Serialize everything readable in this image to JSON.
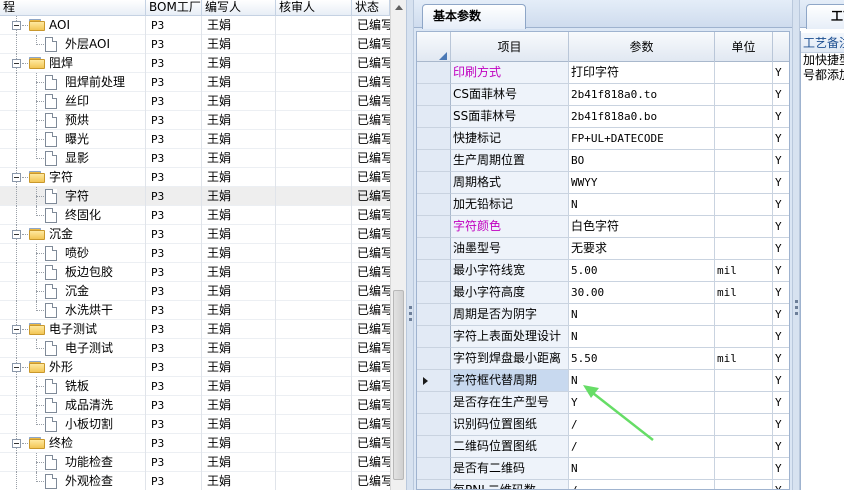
{
  "tree": {
    "columns": [
      "程",
      "BOM工厂",
      "编写人",
      "核审人",
      "状态"
    ],
    "rows": [
      {
        "label": "AOI",
        "type": "folder",
        "factory": "P3",
        "writer": "王娟",
        "status": "已编写"
      },
      {
        "label": "外层AOI",
        "type": "doc",
        "factory": "P3",
        "writer": "王娟",
        "status": "已编写"
      },
      {
        "label": "阻焊",
        "type": "folder",
        "factory": "P3",
        "writer": "王娟",
        "status": "已编写"
      },
      {
        "label": "阻焊前处理",
        "type": "doc",
        "factory": "P3",
        "writer": "王娟",
        "status": "已编写"
      },
      {
        "label": "丝印",
        "type": "doc",
        "factory": "P3",
        "writer": "王娟",
        "status": "已编写"
      },
      {
        "label": "预烘",
        "type": "doc",
        "factory": "P3",
        "writer": "王娟",
        "status": "已编写"
      },
      {
        "label": "曝光",
        "type": "doc",
        "factory": "P3",
        "writer": "王娟",
        "status": "已编写"
      },
      {
        "label": "显影",
        "type": "doc",
        "factory": "P3",
        "writer": "王娟",
        "status": "已编写"
      },
      {
        "label": "字符",
        "type": "folder",
        "factory": "P3",
        "writer": "王娟",
        "status": "已编写"
      },
      {
        "label": "字符",
        "type": "doc",
        "factory": "P3",
        "writer": "王娟",
        "status": "已编写",
        "selected": true
      },
      {
        "label": "终固化",
        "type": "doc",
        "factory": "P3",
        "writer": "王娟",
        "status": "已编写"
      },
      {
        "label": "沉金",
        "type": "folder",
        "factory": "P3",
        "writer": "王娟",
        "status": "已编写"
      },
      {
        "label": "喷砂",
        "type": "doc",
        "factory": "P3",
        "writer": "王娟",
        "status": "已编写"
      },
      {
        "label": "板边包胶",
        "type": "doc",
        "factory": "P3",
        "writer": "王娟",
        "status": "已编写"
      },
      {
        "label": "沉金",
        "type": "doc",
        "factory": "P3",
        "writer": "王娟",
        "status": "已编写"
      },
      {
        "label": "水洗烘干",
        "type": "doc",
        "factory": "P3",
        "writer": "王娟",
        "status": "已编写"
      },
      {
        "label": "电子测试",
        "type": "folder",
        "factory": "P3",
        "writer": "王娟",
        "status": "已编写"
      },
      {
        "label": "电子测试",
        "type": "doc",
        "factory": "P3",
        "writer": "王娟",
        "status": "已编写"
      },
      {
        "label": "外形",
        "type": "folder",
        "factory": "P3",
        "writer": "王娟",
        "status": "已编写"
      },
      {
        "label": "铣板",
        "type": "doc",
        "factory": "P3",
        "writer": "王娟",
        "status": "已编写"
      },
      {
        "label": "成品清洗",
        "type": "doc",
        "factory": "P3",
        "writer": "王娟",
        "status": "已编写"
      },
      {
        "label": "小板切割",
        "type": "doc",
        "factory": "P3",
        "writer": "王娟",
        "status": "已编写"
      },
      {
        "label": "终检",
        "type": "folder",
        "factory": "P3",
        "writer": "王娟",
        "status": "已编写"
      },
      {
        "label": "功能检查",
        "type": "doc",
        "factory": "P3",
        "writer": "王娟",
        "status": "已编写"
      },
      {
        "label": "外观检查",
        "type": "doc",
        "factory": "P3",
        "writer": "王娟",
        "status": "已编写"
      }
    ]
  },
  "params": {
    "tab_label": "基本参数",
    "columns": {
      "item": "项目",
      "value": "参数",
      "unit": "单位"
    },
    "rows": [
      {
        "item": "印刷方式",
        "value": "打印字符",
        "unit": "",
        "extra": "Y",
        "highlight": true
      },
      {
        "item": "CS面菲林号",
        "value": "2b41f818a0.to",
        "unit": "",
        "extra": "Y"
      },
      {
        "item": "SS面菲林号",
        "value": "2b41f818a0.bo",
        "unit": "",
        "extra": "Y"
      },
      {
        "item": "快捷标记",
        "value": "FP+UL+DATECODE",
        "unit": "",
        "extra": "Y"
      },
      {
        "item": "生产周期位置",
        "value": "BO",
        "unit": "",
        "extra": "Y"
      },
      {
        "item": "周期格式",
        "value": "WWYY",
        "unit": "",
        "extra": "Y"
      },
      {
        "item": "加无铅标记",
        "value": "N",
        "unit": "",
        "extra": "Y"
      },
      {
        "item": "字符颜色",
        "value": "白色字符",
        "unit": "",
        "extra": "Y",
        "highlight": true
      },
      {
        "item": "油墨型号",
        "value": "无要求",
        "unit": "",
        "extra": "Y"
      },
      {
        "item": "最小字符线宽",
        "value": "5.00",
        "unit": "mil",
        "extra": "Y"
      },
      {
        "item": "最小字符高度",
        "value": "30.00",
        "unit": "mil",
        "extra": "Y"
      },
      {
        "item": "周期是否为阴字",
        "value": "N",
        "unit": "",
        "extra": "Y"
      },
      {
        "item": "字符上表面处理设计",
        "value": "N",
        "unit": "",
        "extra": "Y"
      },
      {
        "item": "字符到焊盘最小距离",
        "value": "5.50",
        "unit": "mil",
        "extra": "Y"
      },
      {
        "item": "字符框代替周期",
        "value": "N",
        "unit": "",
        "extra": "Y",
        "current": true
      },
      {
        "item": "是否存在生产型号",
        "value": "Y",
        "unit": "",
        "extra": "Y"
      },
      {
        "item": "识别码位置图纸",
        "value": "/",
        "unit": "",
        "extra": "Y"
      },
      {
        "item": "二维码位置图纸",
        "value": "/",
        "unit": "",
        "extra": "Y"
      },
      {
        "item": "是否有二维码",
        "value": "N",
        "unit": "",
        "extra": "Y"
      },
      {
        "item": "每PNL二维码数",
        "value": "/",
        "unit": "",
        "extra": "Y"
      }
    ]
  },
  "notes": {
    "tab_label": "工艺备注",
    "title": "工艺备注",
    "lines": [
      "加快捷型",
      "号都添加"
    ]
  },
  "colors": {
    "highlight_item": "#c000c0",
    "arrow": "#66dd66"
  },
  "icons": [
    "folder-icon",
    "document-icon",
    "row-pointer-icon",
    "expander-icon"
  ]
}
